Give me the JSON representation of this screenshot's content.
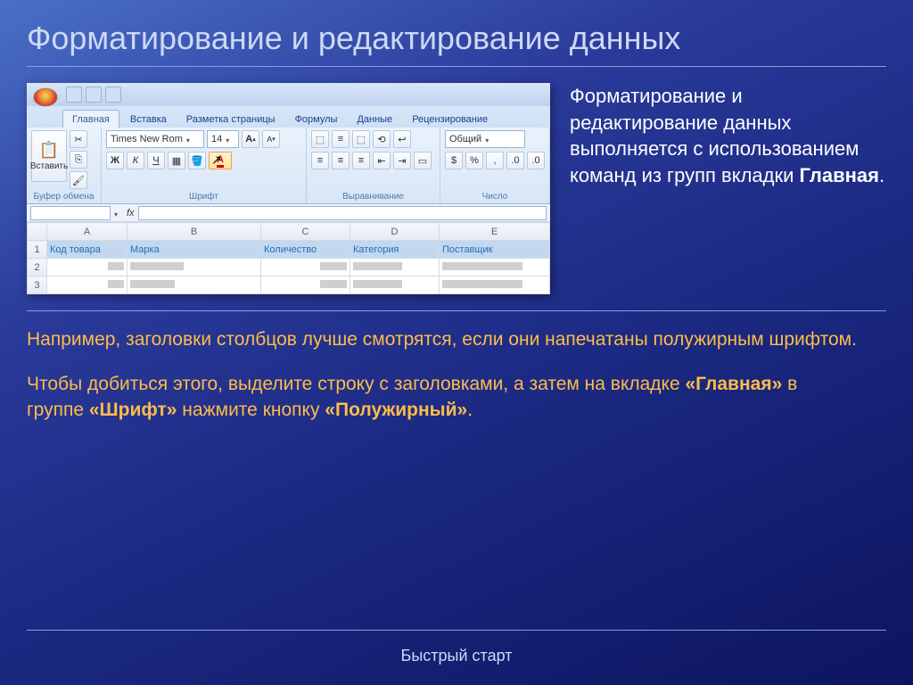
{
  "title": "Форматирование и редактирование данных",
  "footer": "Быстрый старт",
  "side": {
    "line1": "Форматирование и редактирование данных выполняется с использованием команд из групп вкладки ",
    "bold1": "Главная",
    "tail1": "."
  },
  "body": {
    "p1": "Например, заголовки столбцов лучше смотрятся, если они напечатаны полужирным шрифтом.",
    "p2a": "Чтобы добиться этого, выделите строку с заголовками, а затем на вкладке ",
    "p2b1": "«Главная»",
    "p2c": " в группе ",
    "p2b2": "«Шрифт»",
    "p2d": " нажмите кнопку ",
    "p2b3": "«Полужирный»",
    "p2e": "."
  },
  "excel": {
    "tabs": [
      "Главная",
      "Вставка",
      "Разметка страницы",
      "Формулы",
      "Данные",
      "Рецензирование"
    ],
    "font_name": "Times New Rom",
    "font_size": "14",
    "groups": {
      "clipboard": "Буфер обмена",
      "font": "Шрифт",
      "alignment": "Выравнивание",
      "number": "Число"
    },
    "paste": "Вставить",
    "number_format": "Общий",
    "bold": "Ж",
    "italic": "К",
    "underline": "Ч",
    "incfont": "A",
    "decfont": "A",
    "fontcolor": "A",
    "columns": [
      "A",
      "B",
      "C",
      "D",
      "E"
    ],
    "row_nums": [
      "1",
      "2",
      "3"
    ],
    "headers": [
      "Код товара",
      "Марка",
      "Количество",
      "Категория",
      "Поставщик"
    ]
  }
}
